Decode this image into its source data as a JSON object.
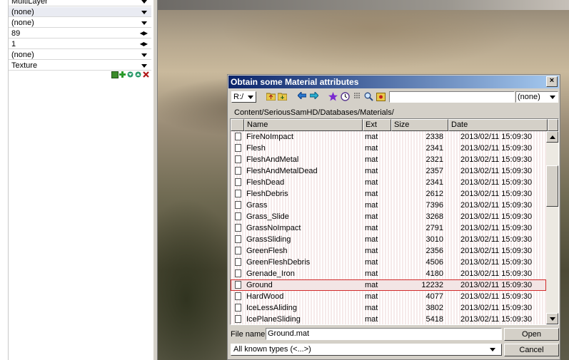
{
  "left_panel": {
    "rows": [
      {
        "value": "MultiLayer",
        "control": "arrow"
      },
      {
        "value": "(none)",
        "control": "arrow"
      },
      {
        "value": "(none)",
        "control": "arrow"
      },
      {
        "value": "89",
        "control": "spin"
      },
      {
        "value": "1",
        "control": "spin"
      },
      {
        "value": "(none)",
        "control": "arrow"
      },
      {
        "value": "Texture",
        "control": "arrow"
      }
    ],
    "toolbar_icons": [
      "copy-icon",
      "add-icon",
      "move-down-icon",
      "move-up-icon",
      "delete-icon"
    ],
    "colors": {
      "selected_row": "#e9ebf2"
    }
  },
  "dialog": {
    "title": "Obtain some Material attributes",
    "close_glyph": "×",
    "toolbar": {
      "drive": "R:/",
      "icons": [
        "folder-up-icon",
        "folder-up2-icon",
        "back-icon",
        "forward-icon",
        "favorite-star-icon",
        "history-icon",
        "list-view-icon",
        "search-icon",
        "bookmark-icon"
      ],
      "path_value": "",
      "filter": "(none)"
    },
    "current_path": "Content/SeriousSamHD/Databases/Materials/",
    "columns": {
      "name": "Name",
      "ext": "Ext",
      "size": "Size",
      "date": "Date"
    },
    "files": [
      {
        "name": "FireNoImpact",
        "ext": "mat",
        "size": "2338",
        "date": "2013/02/11 15:09:30"
      },
      {
        "name": "Flesh",
        "ext": "mat",
        "size": "2341",
        "date": "2013/02/11 15:09:30"
      },
      {
        "name": "FleshAndMetal",
        "ext": "mat",
        "size": "2321",
        "date": "2013/02/11 15:09:30"
      },
      {
        "name": "FleshAndMetalDead",
        "ext": "mat",
        "size": "2357",
        "date": "2013/02/11 15:09:30"
      },
      {
        "name": "FleshDead",
        "ext": "mat",
        "size": "2341",
        "date": "2013/02/11 15:09:30"
      },
      {
        "name": "FleshDebris",
        "ext": "mat",
        "size": "2612",
        "date": "2013/02/11 15:09:30"
      },
      {
        "name": "Grass",
        "ext": "mat",
        "size": "7396",
        "date": "2013/02/11 15:09:30"
      },
      {
        "name": "Grass_Slide",
        "ext": "mat",
        "size": "3268",
        "date": "2013/02/11 15:09:30"
      },
      {
        "name": "GrassNoImpact",
        "ext": "mat",
        "size": "2791",
        "date": "2013/02/11 15:09:30"
      },
      {
        "name": "GrassSliding",
        "ext": "mat",
        "size": "3010",
        "date": "2013/02/11 15:09:30"
      },
      {
        "name": "GreenFlesh",
        "ext": "mat",
        "size": "2356",
        "date": "2013/02/11 15:09:30"
      },
      {
        "name": "GreenFleshDebris",
        "ext": "mat",
        "size": "4506",
        "date": "2013/02/11 15:09:30"
      },
      {
        "name": "Grenade_Iron",
        "ext": "mat",
        "size": "4180",
        "date": "2013/02/11 15:09:30"
      },
      {
        "name": "Ground",
        "ext": "mat",
        "size": "12232",
        "date": "2013/02/11 15:09:30",
        "selected": true
      },
      {
        "name": "HardWood",
        "ext": "mat",
        "size": "4077",
        "date": "2013/02/11 15:09:30"
      },
      {
        "name": "IceLessAliding",
        "ext": "mat",
        "size": "3802",
        "date": "2013/02/11 15:09:30"
      },
      {
        "name": "IcePlaneSliding",
        "ext": "mat",
        "size": "5418",
        "date": "2013/02/11 15:09:30"
      }
    ],
    "file_name_label": "File name:",
    "file_name_value": "Ground.mat",
    "file_types": "All known types (<...>)",
    "open_label": "Open",
    "cancel_label": "Cancel",
    "colors": {
      "titlebar_start": "#0a246a",
      "titlebar_end": "#a6caf0",
      "selection_outline": "#d22c2c"
    }
  }
}
